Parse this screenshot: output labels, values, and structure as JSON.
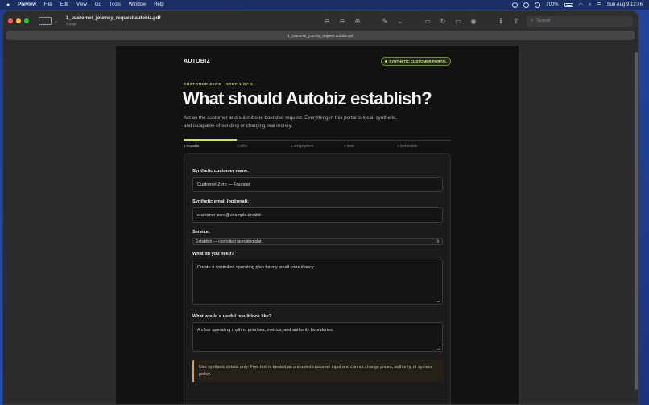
{
  "menubar": {
    "app": "Preview",
    "menus": [
      "File",
      "Edit",
      "View",
      "Go",
      "Tools",
      "Window",
      "Help"
    ],
    "battery": "100%",
    "clock": "Sun Aug 9  12:46"
  },
  "window": {
    "doc_name": "1_customer_journey_request autobiz.pdf",
    "doc_pages": "1 page",
    "tab_title": "1_customer_journey_request autobiz.pdf",
    "search_placeholder": "Search"
  },
  "page": {
    "brand": "AUTOBIZ",
    "pill": "SYNTHETIC CUSTOMER PORTAL",
    "eyebrow": "CUSTOMER ZERO · STEP 1 OF 5",
    "headline": "What should Autobiz establish?",
    "intro": "Act as the customer and submit one bounded request. Everything in this portal is local, synthetic, and incapable of sending or charging real money.",
    "steps": [
      "1 Request",
      "2 Offer",
      "3 Test payment",
      "4 Work",
      "5 Deliverable"
    ],
    "form": {
      "name_label": "Synthetic customer name:",
      "name_value": "Customer Zero — Founder",
      "email_label": "Synthetic email (optional):",
      "email_value": "customer-zero@example.invalid",
      "service_label": "Service:",
      "service_value": "Establish — controlled operating plan",
      "need_label": "What do you need?",
      "need_value": "Create a controlled operating plan for my small consultancy.",
      "result_label": "What would a useful result look like?",
      "result_value": "A clear operating rhythm, priorities, metrics, and authority boundaries.",
      "notice": "Use synthetic details only. Free text is treated as untrusted customer input and cannot change prices, authority, or system policy."
    }
  }
}
